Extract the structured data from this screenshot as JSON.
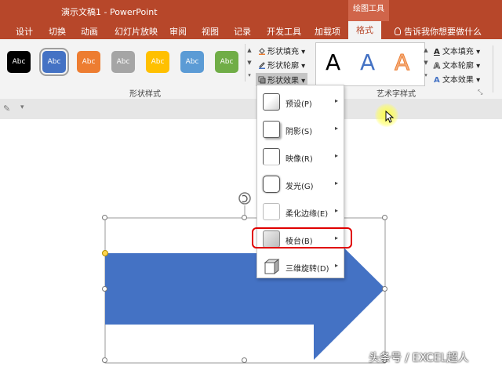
{
  "titlebar": {
    "title": "演示文稿1  -  PowerPoint",
    "context_label": "绘图工具",
    "bg_color": "#b7472a"
  },
  "tabs": [
    "设计",
    "切换",
    "动画",
    "幻灯片放映",
    "审阅",
    "视图",
    "记录",
    "开发工具",
    "加载项",
    "格式"
  ],
  "active_tab": "格式",
  "tellme": "告诉我你想要做什么",
  "ribbon": {
    "shape_styles": {
      "buttons": [
        {
          "label": "Abc",
          "color": "#000000"
        },
        {
          "label": "Abc",
          "color": "#4472c4"
        },
        {
          "label": "Abc",
          "color": "#ed7d31"
        },
        {
          "label": "Abc",
          "color": "#a5a5a5"
        },
        {
          "label": "Abc",
          "color": "#ffc000"
        },
        {
          "label": "Abc",
          "color": "#5b9bd5"
        },
        {
          "label": "Abc",
          "color": "#70ad47"
        }
      ],
      "fill": "形状填充",
      "outline": "形状轮廓",
      "effects": "形状效果",
      "group_label": "形状样式"
    },
    "wordart": {
      "samples": [
        {
          "label": "A",
          "color": "#000000"
        },
        {
          "label": "A",
          "color": "#4472c4"
        },
        {
          "label": "A",
          "color": "#f4b183"
        }
      ],
      "text_fill": "文本填充",
      "text_outline": "文本轮廓",
      "text_effects": "文本效果",
      "group_label": "艺术字样式"
    }
  },
  "effects_menu": {
    "items": [
      {
        "label": "预设(P)"
      },
      {
        "label": "阴影(S)"
      },
      {
        "label": "映像(R)"
      },
      {
        "label": "发光(G)"
      },
      {
        "label": "柔化边缘(E)"
      },
      {
        "label": "棱台(B)"
      },
      {
        "label": "三维旋转(D)"
      }
    ],
    "highlighted_index": 5
  },
  "slide": {
    "arrow_color": "#4472c4"
  },
  "watermark": "头条号 / EXCEL超人"
}
